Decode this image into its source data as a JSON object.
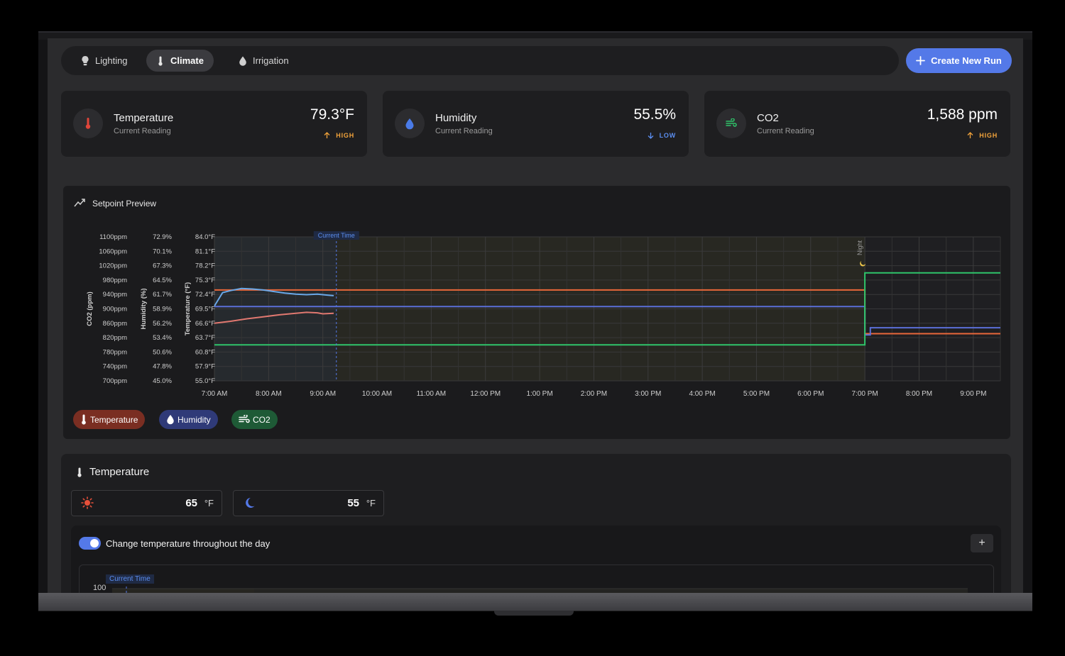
{
  "tabs": [
    {
      "label": "Lighting",
      "icon": "bulb-icon",
      "active": false
    },
    {
      "label": "Climate",
      "icon": "thermometer-icon",
      "active": true
    },
    {
      "label": "Irrigation",
      "icon": "drop-icon",
      "active": false
    }
  ],
  "create_button": {
    "label": "Create New Run"
  },
  "cards": [
    {
      "name": "Temperature",
      "sub": "Current Reading",
      "value": "79.3°F",
      "status": "HIGH",
      "icon": "thermometer-icon"
    },
    {
      "name": "Humidity",
      "sub": "Current Reading",
      "value": "55.5%",
      "status": "LOW",
      "icon": "drop-icon"
    },
    {
      "name": "CO2",
      "sub": "Current Reading",
      "value": "1,588 ppm",
      "status": "HIGH",
      "icon": "wind-icon"
    }
  ],
  "setpoint_panel": {
    "title": "Setpoint Preview"
  },
  "chart_data": {
    "type": "line",
    "x_ticks": [
      "7:00 AM",
      "8:00 AM",
      "9:00 AM",
      "10:00 AM",
      "11:00 AM",
      "12:00 PM",
      "1:00 PM",
      "2:00 PM",
      "3:00 PM",
      "4:00 PM",
      "5:00 PM",
      "6:00 PM",
      "7:00 PM",
      "8:00 PM",
      "9:00 PM"
    ],
    "x_range_hours": [
      7.0,
      21.5
    ],
    "current_time_label": "Current Time",
    "current_time_hour": 9.25,
    "night_label": "Night",
    "night_start_hour": 19.0,
    "axes": [
      {
        "label": "CO2 (ppm)",
        "ticks": [
          "1100ppm",
          "1060ppm",
          "1020ppm",
          "980ppm",
          "940ppm",
          "900ppm",
          "860ppm",
          "820ppm",
          "780ppm",
          "740ppm",
          "700ppm"
        ],
        "range": [
          700,
          1100
        ]
      },
      {
        "label": "Humidity (%)",
        "ticks": [
          "72.9%",
          "70.1%",
          "67.3%",
          "64.5%",
          "61.7%",
          "58.9%",
          "56.2%",
          "53.4%",
          "50.6%",
          "47.8%",
          "45.0%"
        ],
        "range": [
          45.0,
          72.9
        ]
      },
      {
        "label": "Temperature (°F)",
        "ticks": [
          "84.0°F",
          "81.1°F",
          "78.2°F",
          "75.3°F",
          "72.4°F",
          "69.5°F",
          "66.6°F",
          "63.7°F",
          "60.8°F",
          "57.9°F",
          "55.0°F"
        ],
        "range": [
          55.0,
          84.0
        ]
      }
    ],
    "series": [
      {
        "name": "Temperature setpoint",
        "axis": "Temperature (°F)",
        "color": "#e8673a",
        "points": [
          [
            7.0,
            73.3
          ],
          [
            19.0,
            73.3
          ],
          [
            19.0,
            64.5
          ],
          [
            21.5,
            64.5
          ]
        ]
      },
      {
        "name": "Humidity setpoint",
        "axis": "Humidity (%)",
        "color": "#5b6fd8",
        "points": [
          [
            7.0,
            59.4
          ],
          [
            19.0,
            59.4
          ],
          [
            19.0,
            53.9
          ],
          [
            19.1,
            53.9
          ],
          [
            19.1,
            55.3
          ],
          [
            21.5,
            55.3
          ]
        ]
      },
      {
        "name": "CO2 setpoint",
        "axis": "CO2 (ppm)",
        "color": "#2fc46a",
        "points": [
          [
            7.0,
            800
          ],
          [
            19.0,
            800
          ],
          [
            19.0,
            1000
          ],
          [
            21.5,
            1000
          ]
        ]
      },
      {
        "name": "Humidity actual",
        "axis": "Humidity (%)",
        "color": "#6aa8e8",
        "points": [
          [
            7.0,
            59.5
          ],
          [
            7.15,
            62.1
          ],
          [
            7.3,
            62.5
          ],
          [
            7.5,
            62.9
          ],
          [
            7.7,
            62.8
          ],
          [
            7.9,
            62.6
          ],
          [
            8.1,
            62.3
          ],
          [
            8.3,
            62.0
          ],
          [
            8.5,
            61.8
          ],
          [
            8.7,
            61.7
          ],
          [
            8.9,
            61.8
          ],
          [
            9.1,
            61.6
          ],
          [
            9.2,
            61.5
          ]
        ]
      },
      {
        "name": "Temperature actual",
        "axis": "Temperature (°F)",
        "color": "#e07870",
        "points": [
          [
            7.0,
            66.6
          ],
          [
            7.3,
            67.0
          ],
          [
            7.6,
            67.5
          ],
          [
            7.9,
            67.9
          ],
          [
            8.2,
            68.3
          ],
          [
            8.5,
            68.6
          ],
          [
            8.7,
            68.8
          ],
          [
            8.9,
            68.7
          ],
          [
            9.0,
            68.5
          ],
          [
            9.2,
            68.6
          ]
        ]
      }
    ]
  },
  "legend": [
    {
      "label": "Temperature",
      "icon": "thermometer-icon",
      "color": "#7a2e22"
    },
    {
      "label": "Humidity",
      "icon": "drop-icon",
      "color": "#2f3a78"
    },
    {
      "label": "CO2",
      "icon": "wind-icon",
      "color": "#1e5a36"
    }
  ],
  "temperature_section": {
    "title": "Temperature",
    "day_value": "65",
    "night_value": "55",
    "unit": "°F",
    "toggle_label": "Change temperature throughout the day",
    "toggle_on": true,
    "add_label": "+",
    "mini_chart": {
      "current_time_label": "Current Time",
      "y_top": "100"
    }
  }
}
